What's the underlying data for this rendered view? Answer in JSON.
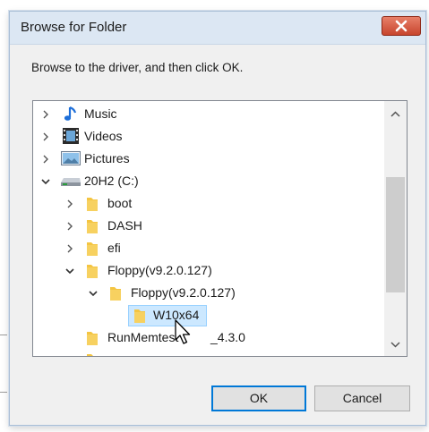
{
  "dialog": {
    "title": "Browse for Folder",
    "instruction": "Browse to the driver, and then click OK.",
    "close_icon": "close-x-icon"
  },
  "tree": {
    "items": [
      {
        "label": "Music",
        "icon": "music-note-icon",
        "expander": "collapsed"
      },
      {
        "label": "Videos",
        "icon": "film-strip-icon",
        "expander": "collapsed"
      },
      {
        "label": "Pictures",
        "icon": "picture-icon",
        "expander": "collapsed"
      },
      {
        "label": "20H2 (C:)",
        "icon": "drive-icon",
        "expander": "expanded"
      },
      {
        "label": "boot",
        "icon": "folder-icon",
        "expander": "collapsed"
      },
      {
        "label": "DASH",
        "icon": "folder-icon",
        "expander": "collapsed"
      },
      {
        "label": "efi",
        "icon": "folder-icon",
        "expander": "collapsed"
      },
      {
        "label": "Floppy(v9.2.0.127)",
        "icon": "folder-icon",
        "expander": "expanded"
      },
      {
        "label": "Floppy(v9.2.0.127)",
        "icon": "folder-icon",
        "expander": "expanded"
      },
      {
        "label": "W10x64",
        "icon": "folder-icon",
        "expander": "none",
        "selected": true
      },
      {
        "label": "RunMemtest",
        "label_tail": "_4.3.0",
        "icon": "folder-icon",
        "expander": "none"
      }
    ]
  },
  "buttons": {
    "ok": "OK",
    "cancel": "Cancel"
  },
  "colors": {
    "selection": "#cce8ff",
    "default_button_border": "#0078d7",
    "close_button": "#c7452d",
    "folder": "#f4c542"
  }
}
